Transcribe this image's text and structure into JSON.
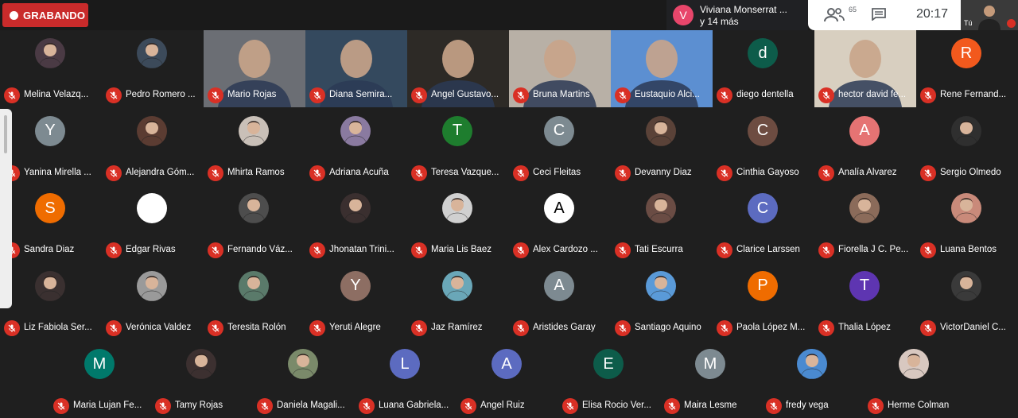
{
  "recording": {
    "label": "GRABANDO"
  },
  "presenter": {
    "initial": "V",
    "line1": "Viviana Monserrat ...",
    "line2": "y 14 más"
  },
  "toolbar": {
    "people_count": "65",
    "clock": "20:17"
  },
  "self_view": {
    "label": "Tú"
  },
  "participants": [
    {
      "name": "Melina Velazq...",
      "type": "photo",
      "color": "#4a3a44"
    },
    {
      "name": "Pedro Romero ...",
      "type": "photo",
      "color": "#3c4a5a"
    },
    {
      "name": "Mario Rojas",
      "type": "video",
      "color": "#6b6e74"
    },
    {
      "name": "Diana Semira...",
      "type": "video",
      "color": "#34495e"
    },
    {
      "name": "Angel Gustavo...",
      "type": "video",
      "color": "#2d2a26"
    },
    {
      "name": "Bruna Martins",
      "type": "video",
      "color": "#b8b0a6"
    },
    {
      "name": "Eustaquio Alci...",
      "type": "video",
      "color": "#5c8fd1"
    },
    {
      "name": "diego dentella",
      "type": "letter",
      "initial": "d",
      "color": "#0d5c4a"
    },
    {
      "name": "hector david fe...",
      "type": "video",
      "color": "#d8cfc0"
    },
    {
      "name": "Rene Fernand...",
      "type": "letter",
      "initial": "R",
      "color": "#f2591d"
    },
    {
      "name": "Yanina Mirella ...",
      "type": "letter",
      "initial": "Y",
      "color": "#7d8a91"
    },
    {
      "name": "Alejandra Góm...",
      "type": "photo",
      "color": "#5b3c32"
    },
    {
      "name": "Mhirta Ramos",
      "type": "photo",
      "color": "#c9c0b8"
    },
    {
      "name": "Adriana Acuña",
      "type": "photo",
      "color": "#8a7aa0"
    },
    {
      "name": "Teresa Vazque...",
      "type": "letter",
      "initial": "T",
      "color": "#1e7d2e"
    },
    {
      "name": "Ceci Fleitas",
      "type": "letter",
      "initial": "C",
      "color": "#7d8a91"
    },
    {
      "name": "Devanny Diaz",
      "type": "photo",
      "color": "#5a4238"
    },
    {
      "name": "Cinthia Gayoso",
      "type": "letter",
      "initial": "C",
      "color": "#6d4c41"
    },
    {
      "name": "Analía Alvarez",
      "type": "letter",
      "initial": "A",
      "color": "#e57373"
    },
    {
      "name": "Sergio Olmedo",
      "type": "photo",
      "color": "#2f2f2f"
    },
    {
      "name": "Sandra Diaz",
      "type": "letter",
      "initial": "S",
      "color": "#ef6c00"
    },
    {
      "name": "Edgar Rivas",
      "type": "letter",
      "initial": "",
      "color": "#ffffff"
    },
    {
      "name": "Fernando Váz...",
      "type": "photo",
      "color": "#4d4d4d"
    },
    {
      "name": "Jhonatan Trini...",
      "type": "photo",
      "color": "#3a2f2f"
    },
    {
      "name": "Maria Lis Baez",
      "type": "photo",
      "color": "#d0d0d0"
    },
    {
      "name": "Alex Cardozo ...",
      "type": "letter",
      "initial": "A",
      "color": "#ffffff",
      "text": "#000000"
    },
    {
      "name": "Tati Escurra",
      "type": "photo",
      "color": "#6a4c44"
    },
    {
      "name": "Clarice Larssen",
      "type": "letter",
      "initial": "C",
      "color": "#5c6bc0"
    },
    {
      "name": "Fiorella J C. Pe...",
      "type": "photo",
      "color": "#8b6b5a"
    },
    {
      "name": "Luana Bentos",
      "type": "photo",
      "color": "#c98a7a"
    },
    {
      "name": "Liz Fabiola Ser...",
      "type": "photo",
      "color": "#3a3030"
    },
    {
      "name": "Verónica Valdez",
      "type": "photo",
      "color": "#9a9a9a"
    },
    {
      "name": "Teresita Rolón",
      "type": "photo",
      "color": "#5a7a6a"
    },
    {
      "name": "Yeruti Alegre",
      "type": "letter",
      "initial": "Y",
      "color": "#8d6e63"
    },
    {
      "name": "Jaz Ramírez",
      "type": "photo",
      "color": "#6aa7b8"
    },
    {
      "name": "Aristides Garay",
      "type": "letter",
      "initial": "A",
      "color": "#7d8a91"
    },
    {
      "name": "Santiago Aquino",
      "type": "photo",
      "color": "#5a9ad8"
    },
    {
      "name": "Paola López M...",
      "type": "letter",
      "initial": "P",
      "color": "#ef6c00"
    },
    {
      "name": "Thalia López",
      "type": "letter",
      "initial": "T",
      "color": "#5e35b1"
    },
    {
      "name": "VictorDaniel C...",
      "type": "photo",
      "color": "#3a3a3a"
    }
  ],
  "bottom_row": [
    {
      "name": "Maria Lujan Fe...",
      "type": "letter",
      "initial": "M",
      "color": "#00796b"
    },
    {
      "name": "Tamy Rojas",
      "type": "photo",
      "color": "#3c3030"
    },
    {
      "name": "Daniela Magali...",
      "type": "photo",
      "color": "#7a8a6a"
    },
    {
      "name": "Luana Gabriela...",
      "type": "letter",
      "initial": "L",
      "color": "#5c6bc0"
    },
    {
      "name": "Angel Ruiz",
      "type": "letter",
      "initial": "A",
      "color": "#5c6bc0"
    },
    {
      "name": "Elisa Rocio Ver...",
      "type": "letter",
      "initial": "E",
      "color": "#0d5c4a"
    },
    {
      "name": "Maira Lesme",
      "type": "letter",
      "initial": "M",
      "color": "#7d8a91"
    },
    {
      "name": "fredy vega",
      "type": "photo",
      "color": "#4a8ad0"
    },
    {
      "name": "Herme Colman",
      "type": "photo",
      "color": "#d8c8c0"
    }
  ]
}
